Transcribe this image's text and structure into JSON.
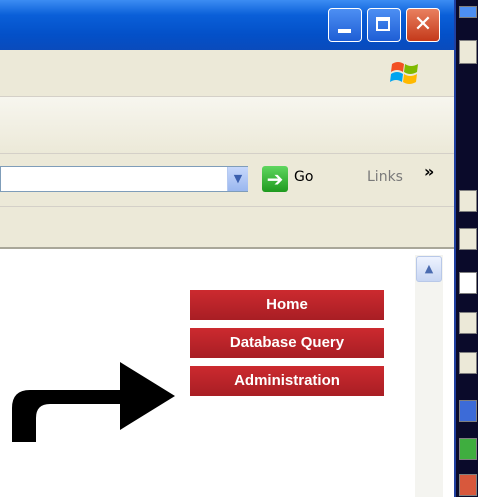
{
  "titlebar": {
    "minimize_icon": "minimize-icon",
    "maximize_icon": "maximize-icon",
    "close_glyph": "✕"
  },
  "addressbar": {
    "go_label": "Go",
    "go_arrow": "➔",
    "links_label": "Links",
    "links_more": "»",
    "dropdown_glyph": "▼"
  },
  "scroll": {
    "up_glyph": "▲"
  },
  "nav": {
    "home": "Home",
    "database_query": "Database Query",
    "administration": "Administration"
  },
  "colors": {
    "titlebar_blue": "#0a5fd8",
    "nav_red": "#b5232a",
    "toolbar_bg": "#ece9d8"
  }
}
